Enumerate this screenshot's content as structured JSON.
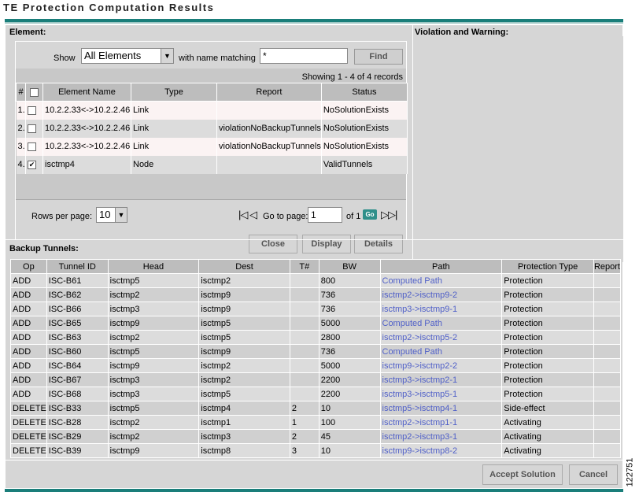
{
  "title": "TE Protection Computation Results",
  "element_section": {
    "heading": "Element:",
    "filter": {
      "show_label": "Show",
      "show_value": "All Elements",
      "match_label": "with name matching",
      "match_value": "*",
      "find_label": "Find"
    },
    "showing": "Showing 1 - 4 of 4 records",
    "columns": [
      "#",
      "",
      "Element Name",
      "Type",
      "Report",
      "Status"
    ],
    "rows": [
      {
        "num": "1.",
        "checked": false,
        "name": "10.2.2.33<->10.2.2.46",
        "type": "Link",
        "report": "",
        "status": "NoSolutionExists"
      },
      {
        "num": "2.",
        "checked": false,
        "name": "10.2.2.33<->10.2.2.46",
        "type": "Link",
        "report": "violationNoBackupTunnels",
        "status": "NoSolutionExists"
      },
      {
        "num": "3.",
        "checked": false,
        "name": "10.2.2.33<->10.2.2.46",
        "type": "Link",
        "report": "violationNoBackupTunnels",
        "status": "NoSolutionExists"
      },
      {
        "num": "4.",
        "checked": true,
        "name": "isctmp4",
        "type": "Node",
        "report": "",
        "status": "ValidTunnels"
      }
    ],
    "pager": {
      "rows_per_page_label": "Rows per page:",
      "rows_per_page": "10",
      "goto_label": "Go to page:",
      "page": "1",
      "of_label": "of 1",
      "go_label": "Go"
    },
    "buttons": {
      "close": "Close",
      "display": "Display",
      "details": "Details"
    }
  },
  "violation_section": {
    "heading": "Violation and Warning:"
  },
  "backup_section": {
    "heading": "Backup Tunnels:",
    "columns": [
      "Op",
      "Tunnel ID",
      "Head",
      "Dest",
      "T#",
      "BW",
      "Path",
      "Protection Type",
      "Report"
    ],
    "rows": [
      {
        "op": "ADD",
        "id": "ISC-B61",
        "head": "isctmp5",
        "dest": "isctmp2",
        "t": "",
        "bw": "800",
        "path": "Computed Path",
        "ptype": "Protection",
        "report": ""
      },
      {
        "op": "ADD",
        "id": "ISC-B62",
        "head": "isctmp2",
        "dest": "isctmp9",
        "t": "",
        "bw": "736",
        "path": "isctmp2->isctmp9-2",
        "ptype": "Protection",
        "report": ""
      },
      {
        "op": "ADD",
        "id": "ISC-B66",
        "head": "isctmp3",
        "dest": "isctmp9",
        "t": "",
        "bw": "736",
        "path": "isctmp3->isctmp9-1",
        "ptype": "Protection",
        "report": ""
      },
      {
        "op": "ADD",
        "id": "ISC-B65",
        "head": "isctmp9",
        "dest": "isctmp5",
        "t": "",
        "bw": "5000",
        "path": "Computed Path",
        "ptype": "Protection",
        "report": ""
      },
      {
        "op": "ADD",
        "id": "ISC-B63",
        "head": "isctmp2",
        "dest": "isctmp5",
        "t": "",
        "bw": "2800",
        "path": "isctmp2->isctmp5-2",
        "ptype": "Protection",
        "report": ""
      },
      {
        "op": "ADD",
        "id": "ISC-B60",
        "head": "isctmp5",
        "dest": "isctmp9",
        "t": "",
        "bw": "736",
        "path": "Computed Path",
        "ptype": "Protection",
        "report": ""
      },
      {
        "op": "ADD",
        "id": "ISC-B64",
        "head": "isctmp9",
        "dest": "isctmp2",
        "t": "",
        "bw": "5000",
        "path": "isctmp9->isctmp2-2",
        "ptype": "Protection",
        "report": ""
      },
      {
        "op": "ADD",
        "id": "ISC-B67",
        "head": "isctmp3",
        "dest": "isctmp2",
        "t": "",
        "bw": "2200",
        "path": "isctmp3->isctmp2-1",
        "ptype": "Protection",
        "report": ""
      },
      {
        "op": "ADD",
        "id": "ISC-B68",
        "head": "isctmp3",
        "dest": "isctmp5",
        "t": "",
        "bw": "2200",
        "path": "isctmp3->isctmp5-1",
        "ptype": "Protection",
        "report": ""
      },
      {
        "op": "DELETE",
        "id": "ISC-B33",
        "head": "isctmp5",
        "dest": "isctmp4",
        "t": "2",
        "bw": "10",
        "path": "isctmp5->isctmp4-1",
        "ptype": "Side-effect",
        "report": ""
      },
      {
        "op": "DELETE",
        "id": "ISC-B28",
        "head": "isctmp2",
        "dest": "isctmp1",
        "t": "1",
        "bw": "100",
        "path": "isctmp2->isctmp1-1",
        "ptype": "Activating",
        "report": ""
      },
      {
        "op": "DELETE",
        "id": "ISC-B29",
        "head": "isctmp2",
        "dest": "isctmp3",
        "t": "2",
        "bw": "45",
        "path": "isctmp2->isctmp3-1",
        "ptype": "Activating",
        "report": ""
      },
      {
        "op": "DELETE",
        "id": "ISC-B39",
        "head": "isctmp9",
        "dest": "isctmp8",
        "t": "3",
        "bw": "10",
        "path": "isctmp9->isctmp8-2",
        "ptype": "Activating",
        "report": ""
      }
    ],
    "buttons": {
      "accept": "Accept Solution",
      "cancel": "Cancel"
    }
  },
  "figure_number": "122751",
  "colors": {
    "accent": "#1a7e7a",
    "link": "#5060c8",
    "panel": "#d6d6d6"
  }
}
